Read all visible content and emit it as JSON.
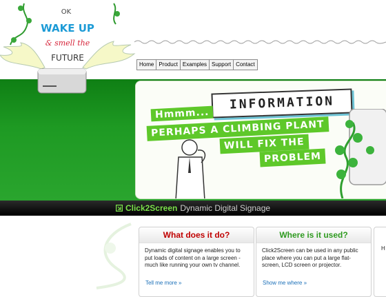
{
  "header": {
    "logo_text": [
      "OK",
      "WAKE UP",
      "& smell the",
      "FUTURE"
    ]
  },
  "nav": {
    "items": [
      "Home",
      "Product",
      "Examples",
      "Support",
      "Contact"
    ]
  },
  "banner": {
    "title": "INFORMATION",
    "lines": [
      "Hmmm...",
      "PERHAPS A CLIMBING PLANT",
      "WILL FIX THE",
      "PROBLEM"
    ]
  },
  "bar": {
    "brand": "Click2Screen",
    "tagline": "Dynamic Digital Signage"
  },
  "panels": [
    {
      "title": "What does it do?",
      "title_color": "#c00000",
      "body": "Dynamic digital signage enables you to put loads of content on a large screen - much like running your own tv channel.",
      "link": "Tell me more »"
    },
    {
      "title": "Where is it used?",
      "title_color": "#2e9a1f",
      "body": "Click2Screen can be used in any public place where you can put a large flat-screen, LCD screen or projector.",
      "link": "Show me where »"
    },
    {
      "title": "",
      "body": "H C In",
      "link": ""
    }
  ],
  "colors": {
    "green": "#1e9a23",
    "brand_green": "#7be04a",
    "link_blue": "#1a6fb8"
  }
}
